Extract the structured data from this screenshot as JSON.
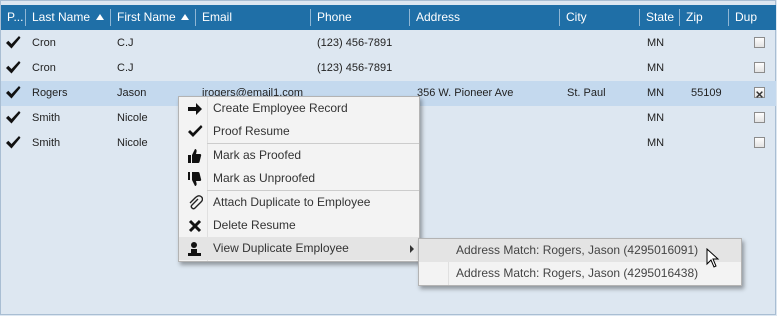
{
  "columns": [
    {
      "key": "proofed",
      "label": "P..."
    },
    {
      "key": "last_name",
      "label": "Last Name",
      "sort": "asc"
    },
    {
      "key": "first_name",
      "label": "First Name",
      "sort": "asc"
    },
    {
      "key": "email",
      "label": "Email"
    },
    {
      "key": "phone",
      "label": "Phone"
    },
    {
      "key": "address",
      "label": "Address"
    },
    {
      "key": "city",
      "label": "City"
    },
    {
      "key": "state",
      "label": "State"
    },
    {
      "key": "zip",
      "label": "Zip"
    },
    {
      "key": "dup",
      "label": "Dup"
    }
  ],
  "rows": [
    {
      "proofed": true,
      "last_name": "Cron",
      "first_name": "C.J",
      "email": "",
      "phone": "(123) 456-7891",
      "address": "",
      "city": "",
      "state": "MN",
      "zip": "",
      "dup": false,
      "selected": false
    },
    {
      "proofed": true,
      "last_name": "Cron",
      "first_name": "C.J",
      "email": "",
      "phone": "(123) 456-7891",
      "address": "",
      "city": "",
      "state": "MN",
      "zip": "",
      "dup": false,
      "selected": false
    },
    {
      "proofed": true,
      "last_name": "Rogers",
      "first_name": "Jason",
      "email": "jrogers@email1.com",
      "phone": "",
      "address": "356 W. Pioneer Ave",
      "city": "St. Paul",
      "state": "MN",
      "zip": "55109",
      "dup": true,
      "selected": true
    },
    {
      "proofed": true,
      "last_name": "Smith",
      "first_name": "Nicole",
      "email": "",
      "phone": "",
      "address": "",
      "city": "",
      "state": "MN",
      "zip": "",
      "dup": false,
      "selected": false
    },
    {
      "proofed": true,
      "last_name": "Smith",
      "first_name": "Nicole",
      "email": "",
      "phone": "",
      "address": "",
      "city": "",
      "state": "MN",
      "zip": "",
      "dup": false,
      "selected": false
    }
  ],
  "context_menu": {
    "items": [
      {
        "label": "Create Employee Record",
        "icon": "arrow-right-icon"
      },
      {
        "label": "Proof Resume",
        "icon": "checkmark-icon"
      },
      {
        "label": "Mark as Proofed",
        "icon": "thumbs-up-icon"
      },
      {
        "label": "Mark as Unproofed",
        "icon": "thumbs-down-icon"
      },
      {
        "label": "Attach Duplicate to Employee",
        "icon": "paperclip-icon"
      },
      {
        "label": "Delete Resume",
        "icon": "x-icon"
      },
      {
        "label": "View Duplicate Employee",
        "icon": "person-icon",
        "has_submenu": true
      }
    ]
  },
  "submenu": {
    "items": [
      {
        "label": "Address Match: Rogers, Jason (4295016091)"
      },
      {
        "label": "Address Match: Rogers, Jason (4295016438)"
      }
    ]
  },
  "colors": {
    "header_bg": "#1f6fa7",
    "grid_bg": "#dde7f1",
    "selected_row": "#c4d9ee",
    "menu_bg": "#f3f3f3",
    "menu_hover": "#e4e4e4"
  }
}
